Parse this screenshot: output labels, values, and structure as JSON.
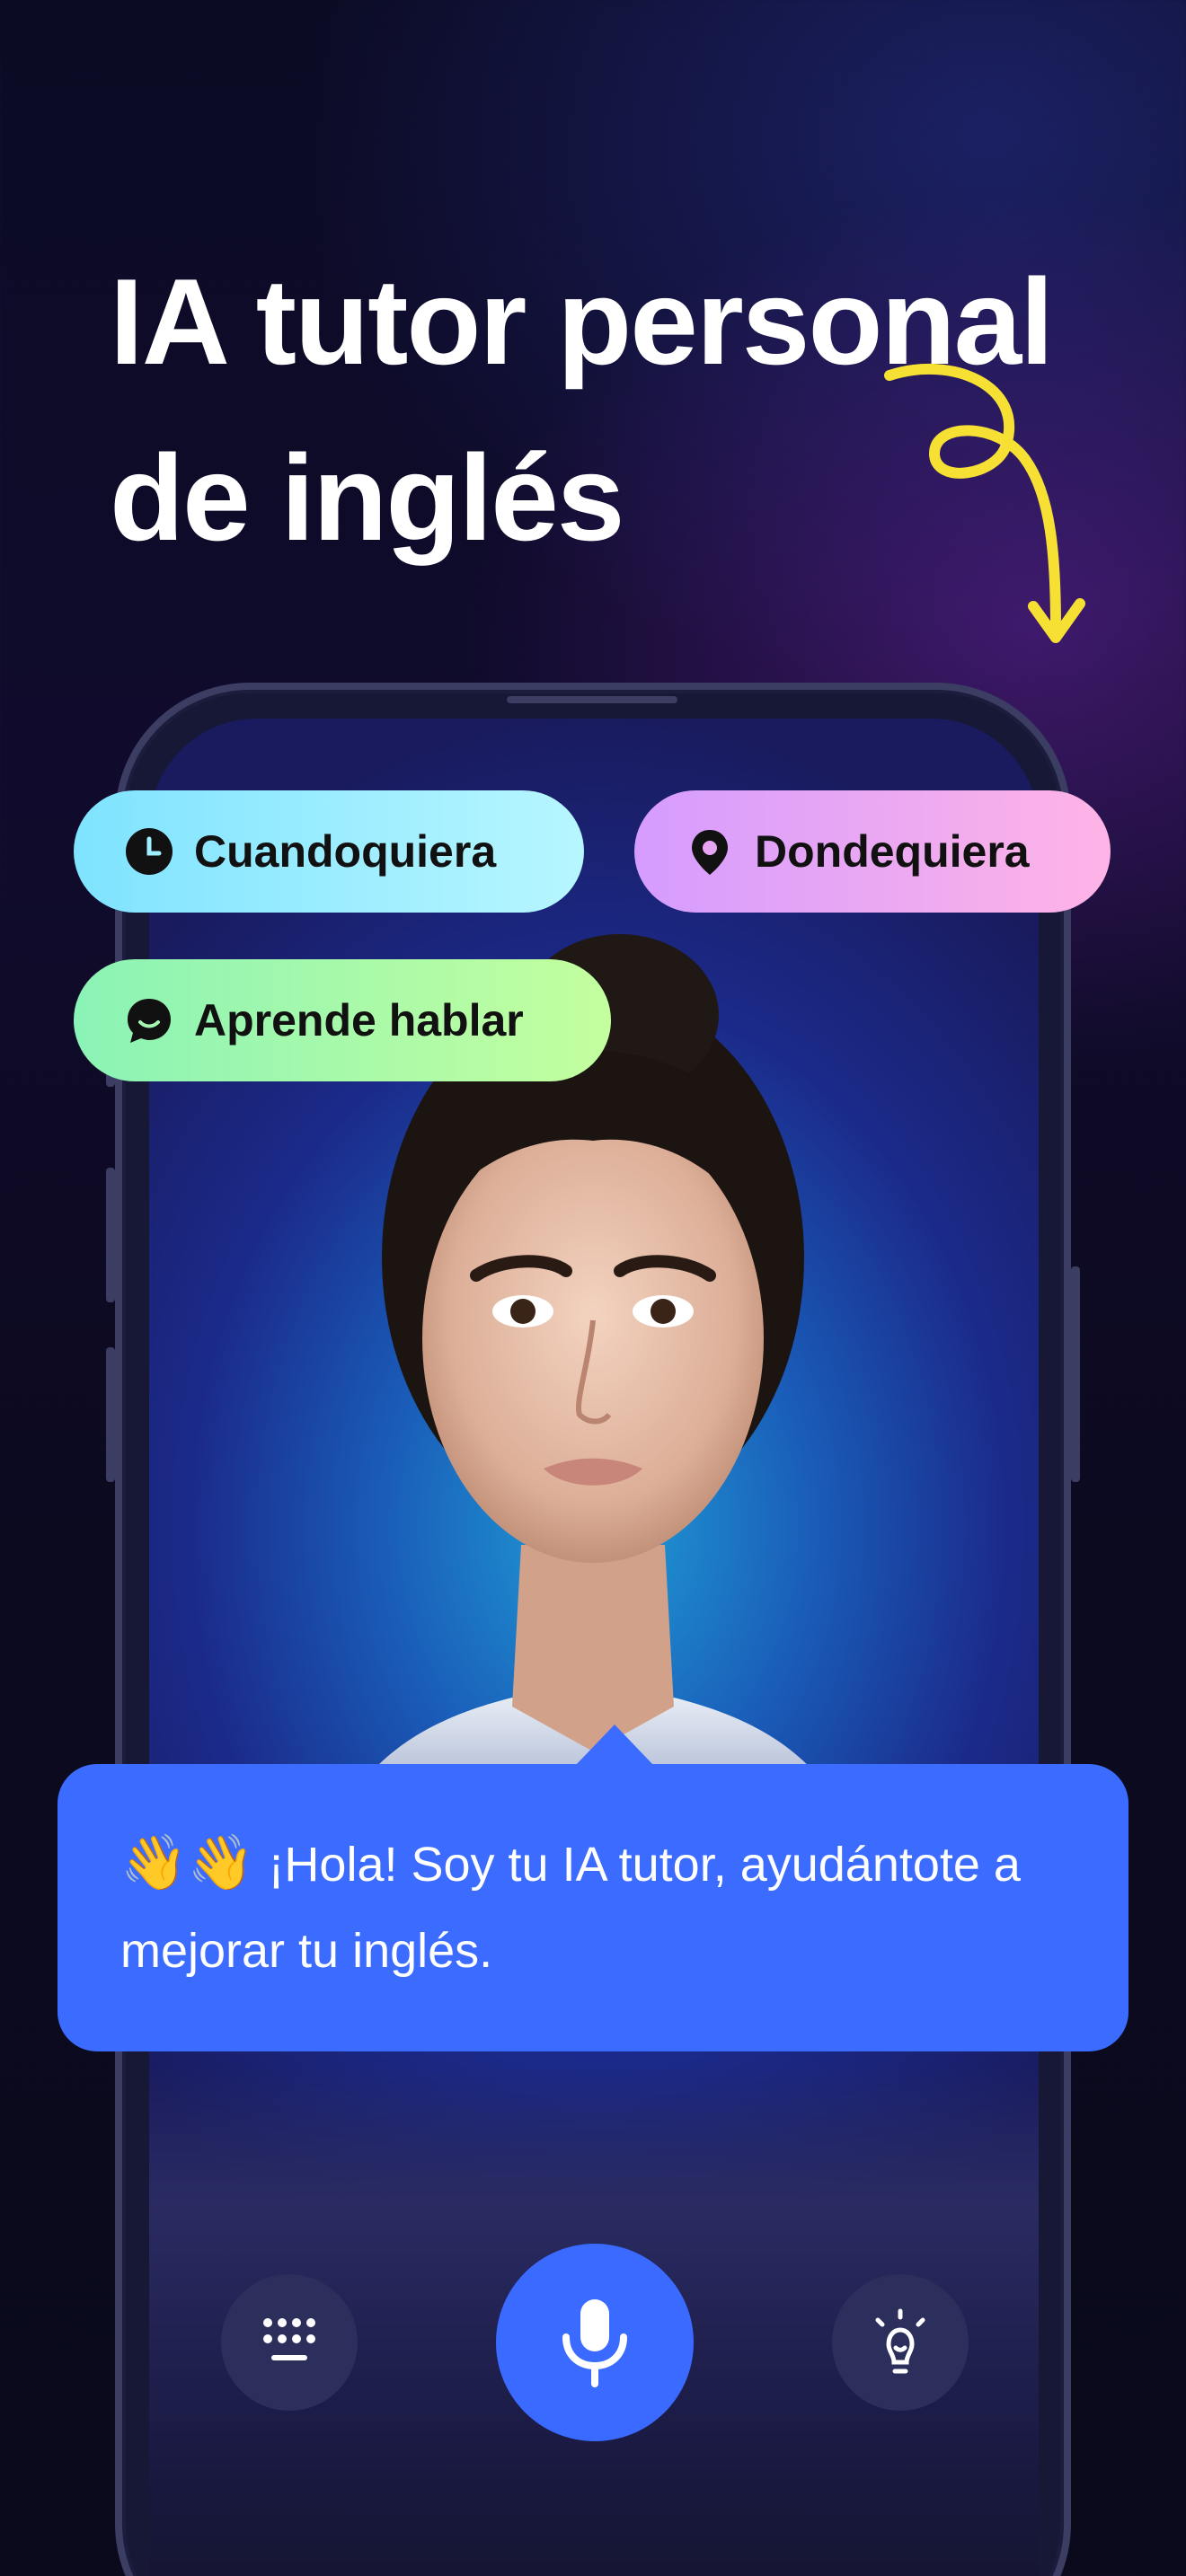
{
  "headline": {
    "line1": "IA tutor personal",
    "line2": "de inglés"
  },
  "chips": [
    {
      "label": "Cuandoquiera",
      "icon": "clock-icon"
    },
    {
      "label": "Dondequiera",
      "icon": "location-pin-icon"
    },
    {
      "label": "Aprende hablar",
      "icon": "chat-bubble-icon"
    }
  ],
  "bubble": {
    "emoji": "👋👋",
    "text": "¡Hola! Soy tu IA tutor, ayudántote a mejorar tu inglés."
  },
  "controls": {
    "keyboard_icon": "keyboard-icon",
    "mic_icon": "microphone-icon",
    "hint_icon": "lightbulb-icon"
  },
  "colors": {
    "accent": "#3b6cff",
    "swirl": "#f7e034",
    "chip1": "#7fe3ff",
    "chip2": "#d59cff",
    "chip3": "#8af3b6"
  }
}
